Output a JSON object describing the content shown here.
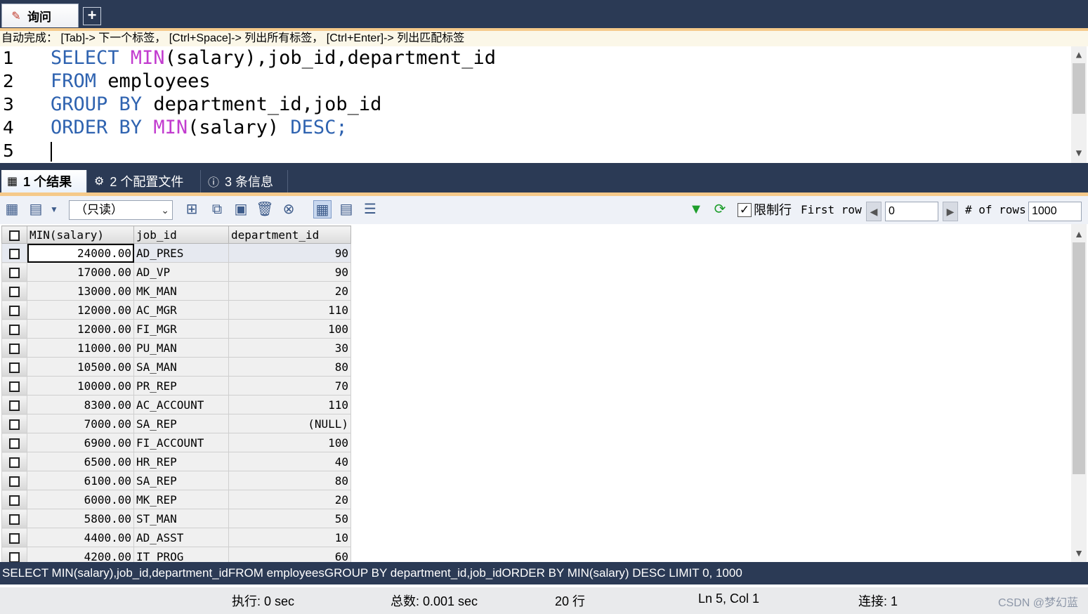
{
  "top_tabs": {
    "query_tab_label": "询问",
    "add_tab_label": "+"
  },
  "autocomplete_hint": "自动完成： [Tab]-> 下一个标签， [Ctrl+Space]-> 列出所有标签， [Ctrl+Enter]-> 列出匹配标签",
  "editor": {
    "line_numbers": [
      "1",
      "2",
      "3",
      "4",
      "5"
    ],
    "lines": [
      [
        {
          "t": "SELECT ",
          "c": "kw"
        },
        {
          "t": "MIN",
          "c": "fn"
        },
        {
          "t": "(salary),job_id,department_id",
          "c": ""
        }
      ],
      [
        {
          "t": "FROM ",
          "c": "kw"
        },
        {
          "t": "employees",
          "c": ""
        }
      ],
      [
        {
          "t": "GROUP BY ",
          "c": "kw"
        },
        {
          "t": "department_id,job_id",
          "c": ""
        }
      ],
      [
        {
          "t": "ORDER BY ",
          "c": "kw"
        },
        {
          "t": "MIN",
          "c": "fn"
        },
        {
          "t": "(salary) ",
          "c": ""
        },
        {
          "t": "DESC;",
          "c": "kw"
        }
      ],
      []
    ]
  },
  "result_tabs": [
    {
      "label": "1 个结果",
      "icon": "table-icon",
      "active": true
    },
    {
      "label": "2 个配置文件",
      "icon": "profile-icon",
      "active": false
    },
    {
      "label": "3 条信息",
      "icon": "info-icon",
      "active": false
    }
  ],
  "toolbar": {
    "mode_select": "（只读）",
    "limit_label": "限制行",
    "limit_checked": true,
    "first_row_label": "First row",
    "first_row_value": "0",
    "rows_label": "# of rows",
    "rows_value": "1000"
  },
  "grid": {
    "columns": [
      "MIN(salary)",
      "job_id",
      "department_id"
    ],
    "rows": [
      [
        "24000.00",
        "AD_PRES",
        "90"
      ],
      [
        "17000.00",
        "AD_VP",
        "90"
      ],
      [
        "13000.00",
        "MK_MAN",
        "20"
      ],
      [
        "12000.00",
        "AC_MGR",
        "110"
      ],
      [
        "12000.00",
        "FI_MGR",
        "100"
      ],
      [
        "11000.00",
        "PU_MAN",
        "30"
      ],
      [
        "10500.00",
        "SA_MAN",
        "80"
      ],
      [
        "10000.00",
        "PR_REP",
        "70"
      ],
      [
        "8300.00",
        "AC_ACCOUNT",
        "110"
      ],
      [
        "7000.00",
        "SA_REP",
        "(NULL)"
      ],
      [
        "6900.00",
        "FI_ACCOUNT",
        "100"
      ],
      [
        "6500.00",
        "HR_REP",
        "40"
      ],
      [
        "6100.00",
        "SA_REP",
        "80"
      ],
      [
        "6000.00",
        "MK_REP",
        "20"
      ],
      [
        "5800.00",
        "ST_MAN",
        "50"
      ],
      [
        "4400.00",
        "AD_ASST",
        "10"
      ],
      [
        "4200.00",
        "IT_PROG",
        "60"
      ]
    ]
  },
  "sql_status": "SELECT MIN(salary),job_id,department_idFROM employeesGROUP BY department_id,job_idORDER BY MIN(salary) DESC LIMIT 0, 1000",
  "statusbar": {
    "exec": "执行: 0 sec",
    "total": "总数: 0.001 sec",
    "rows": "20 行",
    "position": "Ln 5, Col 1",
    "connection": "连接: 1",
    "watermark": "CSDN @梦幻蓝"
  },
  "colors": {
    "chrome": "#2b3a55",
    "keyword": "#2f63b0",
    "function": "#c23ccf",
    "accent_strip": "#f5c98a"
  }
}
